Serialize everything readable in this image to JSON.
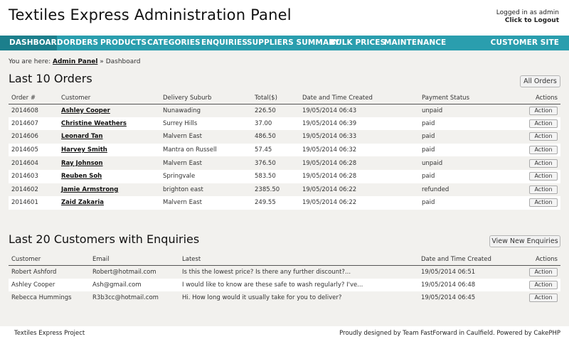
{
  "header": {
    "title": "Textiles Express Administration Panel",
    "logged_in": "Logged in as admin",
    "logout": "Click to Logout"
  },
  "nav": {
    "items": [
      "DASHBOARD",
      "ORDERS",
      "PRODUCTS",
      "CATEGORIES",
      "ENQUIRIES",
      "SUPPLIERS SUMMARY",
      "BULK PRICES",
      "MAINTENANCE"
    ],
    "right": "CUSTOMER SITE",
    "active_color": "#1c7f8c",
    "bar_color": "#2a9eae"
  },
  "breadcrumb": {
    "prefix": "You are here:",
    "link": "Admin Panel",
    "separator": "»",
    "current": "Dashboard"
  },
  "orders": {
    "title": "Last 10 Orders",
    "all_button": "All Orders",
    "headers": [
      "Order #",
      "Customer",
      "Delivery Suburb",
      "Total($)",
      "Date and Time Created",
      "Payment Status",
      "Actions"
    ],
    "action_label": "Action",
    "rows": [
      [
        "2014608",
        "Ashley Cooper",
        "Nunawading",
        "226.50",
        "19/05/2014 06:43",
        "unpaid"
      ],
      [
        "2014607",
        "Christine Weathers",
        "Surrey Hills",
        "37.00",
        "19/05/2014 06:39",
        "paid"
      ],
      [
        "2014606",
        "Leonard Tan",
        "Malvern East",
        "486.50",
        "19/05/2014 06:33",
        "paid"
      ],
      [
        "2014605",
        "Harvey Smith",
        "Mantra on Russell",
        "57.45",
        "19/05/2014 06:32",
        "paid"
      ],
      [
        "2014604",
        "Ray Johnson",
        "Malvern East",
        "376.50",
        "19/05/2014 06:28",
        "unpaid"
      ],
      [
        "2014603",
        "Reuben Soh",
        "Springvale",
        "583.50",
        "19/05/2014 06:28",
        "paid"
      ],
      [
        "2014602",
        "Jamie Armstrong",
        "brighton east",
        "2385.50",
        "19/05/2014 06:22",
        "refunded"
      ],
      [
        "2014601",
        "Zaid Zakaria",
        "Malvern East",
        "249.55",
        "19/05/2014 06:22",
        "paid"
      ]
    ]
  },
  "enquiries": {
    "title": "Last 20 Customers with Enquiries",
    "view_button": "View New Enquiries",
    "headers": [
      "Customer",
      "Email",
      "Latest",
      "Date and Time Created",
      "Actions"
    ],
    "action_label": "Action",
    "rows": [
      [
        "Robert Ashford",
        "Robert@hotmail.com",
        "Is this the lowest price? Is there any further discount?...",
        "19/05/2014 06:51"
      ],
      [
        "Ashley Cooper",
        "Ash@gmail.com",
        "I would like to know are these safe to wash regularly? I've...",
        "19/05/2014 06:48"
      ],
      [
        "Rebecca Hummings",
        "R3b3cc@hotmail.com",
        "Hi. How long would it usually take for you to deliver?",
        "19/05/2014 06:45"
      ]
    ]
  },
  "footer": {
    "left": "Textiles Express Project",
    "right": "Proudly designed by Team FastForward in Caulfield. Powered by CakePHP"
  }
}
